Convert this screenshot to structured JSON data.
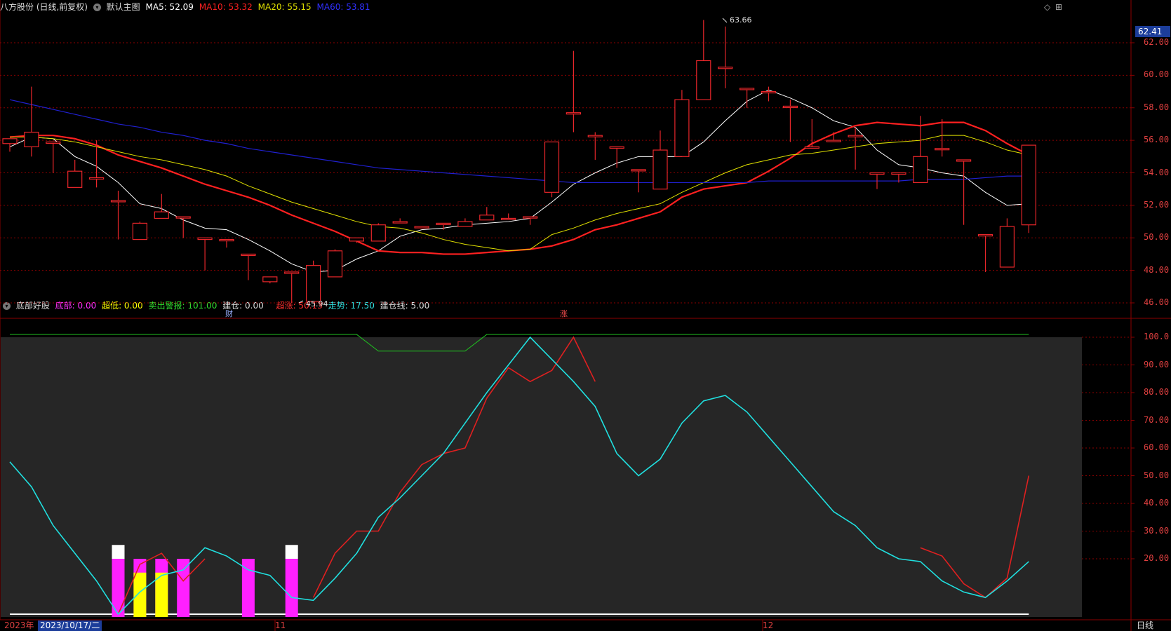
{
  "header_top": {
    "stock_label": "八方股份 (日线,前复权)",
    "main_chart_label": "默认主图",
    "ma5": "MA5: 52.09",
    "ma10": "MA10: 53.32",
    "ma20": "MA20: 55.15",
    "ma60": "MA60: 53.81"
  },
  "header_bottom": {
    "indicator_name": "底部好股",
    "dibu": "底部: 0.00",
    "chaodi": "超低: 0.00",
    "maichu": "卖出警报: 101.00",
    "jiancang": "建仓: 0.00",
    "chaozhang": "超涨: 50.13",
    "zoushi": "走势: 17.50",
    "jiancangxian": "建仓线: 5.00"
  },
  "price_axis_labels": [
    "62.00",
    "60.00",
    "58.00",
    "56.00",
    "54.00",
    "52.00",
    "50.00",
    "48.00",
    "46.00"
  ],
  "current_price_tag": "62.41",
  "indicator_axis_labels": [
    "100.0",
    "90.00",
    "80.00",
    "70.00",
    "60.00",
    "50.00",
    "40.00",
    "30.00",
    "20.00"
  ],
  "annotations": {
    "high": "63.66",
    "low": "45.94",
    "cai": "财",
    "zhang": "涨"
  },
  "date_axis": {
    "year": "2023年",
    "selected_date": "2023/10/17/二",
    "month_11": "11",
    "month_12": "12",
    "period": "日线"
  },
  "icons": {
    "collapse": "chevron-down-icon",
    "diamond": "diamond-icon",
    "settings": "settings-icon"
  },
  "colors": {
    "up": "#e8262a",
    "down": "#00f0f0",
    "ma5": "#ffffff",
    "ma10": "#ff2020",
    "ma20": "#e0e000",
    "ma60": "#2020d0",
    "grid": "#8b0000"
  },
  "chart_data": [
    {
      "type": "candlestick",
      "title": "八方股份 (日线,前复权)",
      "ylim": [
        45,
        63.5
      ],
      "series": [
        {
          "name": "K线",
          "ohlc": [
            [
              55.8,
              56.1,
              55.6,
              55.3
            ],
            [
              55.6,
              56.5,
              55.0,
              59.3
            ],
            [
              55.9,
              55.9,
              54.1,
              54.0
            ],
            [
              53.1,
              54.1,
              53.1,
              54.8
            ],
            [
              53.7,
              53.7,
              53.1,
              56.0
            ],
            [
              52.3,
              52.3,
              49.9,
              52.9
            ],
            [
              49.9,
              50.9,
              49.9,
              51.0
            ],
            [
              51.2,
              51.6,
              51.2,
              52.7
            ],
            [
              51.3,
              51.3,
              50.0,
              50.0
            ],
            [
              49.9,
              50.0,
              49.9,
              48.0
            ],
            [
              49.9,
              49.9,
              49.4,
              49.4
            ],
            [
              49.0,
              49.0,
              47.9,
              47.4
            ],
            [
              47.3,
              47.6,
              47.3,
              47.2
            ],
            [
              47.9,
              47.9,
              46.1,
              46.0
            ],
            [
              46.1,
              48.3,
              46.1,
              48.6
            ],
            [
              47.6,
              49.2,
              47.6,
              49.3
            ],
            [
              49.8,
              50.0,
              49.8,
              49.7
            ],
            [
              49.8,
              50.8,
              49.8,
              50.9
            ],
            [
              51.0,
              51.0,
              50.9,
              51.2
            ],
            [
              50.7,
              50.7,
              50.6,
              50.6
            ],
            [
              50.9,
              50.9,
              50.8,
              50.5
            ],
            [
              50.7,
              51.0,
              50.7,
              51.2
            ],
            [
              51.1,
              51.4,
              51.1,
              51.9
            ],
            [
              51.2,
              51.2,
              51.1,
              51.5
            ],
            [
              51.3,
              51.3,
              50.8,
              50.8
            ],
            [
              52.8,
              55.9,
              52.8,
              52.5
            ],
            [
              57.7,
              57.7,
              56.5,
              61.5
            ],
            [
              56.3,
              56.3,
              54.8,
              56.5
            ],
            [
              55.6,
              55.6,
              54.9,
              54.3
            ],
            [
              54.2,
              54.2,
              52.8,
              52.8
            ],
            [
              53.0,
              55.4,
              53.0,
              56.6
            ],
            [
              55.0,
              58.5,
              55.0,
              59.1
            ],
            [
              58.5,
              60.9,
              58.5,
              63.4
            ],
            [
              60.5,
              60.5,
              59.2,
              63.0
            ],
            [
              59.2,
              59.2,
              59.0,
              58.0
            ],
            [
              59.0,
              59.0,
              58.4,
              59.3
            ],
            [
              58.1,
              58.1,
              55.9,
              58.5
            ],
            [
              55.6,
              55.6,
              55.6,
              57.3
            ],
            [
              56.0,
              56.0,
              56.1,
              56.5
            ],
            [
              56.3,
              56.3,
              54.2,
              56.8
            ],
            [
              54.0,
              54.0,
              54.0,
              53.0
            ],
            [
              54.0,
              54.0,
              53.4,
              53.6
            ],
            [
              53.4,
              55.0,
              53.4,
              57.5
            ],
            [
              55.5,
              55.5,
              55.0,
              57.3
            ],
            [
              54.8,
              54.8,
              50.9,
              50.8
            ],
            [
              50.2,
              50.2,
              48.0,
              47.9
            ],
            [
              48.2,
              50.7,
              48.2,
              51.2
            ],
            [
              50.8,
              55.7,
              50.8,
              50.3
            ]
          ]
        },
        {
          "name": "MA5",
          "values": [
            55.6,
            56.2,
            56.1,
            55.0,
            54.4,
            53.4,
            52.1,
            51.8,
            51.1,
            50.6,
            50.5,
            49.9,
            49.2,
            48.4,
            47.9,
            48.0,
            48.7,
            49.2,
            50.1,
            50.5,
            50.6,
            50.8,
            50.9,
            51.0,
            51.2,
            52.2,
            53.3,
            54.0,
            54.6,
            55.0,
            55.0,
            55.0,
            55.9,
            57.2,
            58.4,
            59.1,
            58.6,
            58.0,
            57.2,
            56.8,
            55.4,
            54.5,
            54.3,
            54.0,
            53.8,
            52.8,
            52.0,
            52.1
          ]
        },
        {
          "name": "MA10",
          "values": [
            56.2,
            56.3,
            56.3,
            56.1,
            55.7,
            55.1,
            54.7,
            54.3,
            53.8,
            53.3,
            52.9,
            52.5,
            52.0,
            51.4,
            50.9,
            50.4,
            49.8,
            49.2,
            49.1,
            49.1,
            49.0,
            49.0,
            49.1,
            49.2,
            49.3,
            49.5,
            49.9,
            50.5,
            50.8,
            51.2,
            51.6,
            52.5,
            53.0,
            53.2,
            53.4,
            54.1,
            54.9,
            55.8,
            56.4,
            56.9,
            57.1,
            57.0,
            56.9,
            57.1,
            57.1,
            56.6,
            55.8,
            55.1
          ]
        },
        {
          "name": "MA20",
          "values": [
            56.2,
            56.2,
            56.1,
            55.9,
            55.6,
            55.3,
            55.0,
            54.8,
            54.5,
            54.2,
            53.8,
            53.2,
            52.7,
            52.2,
            51.8,
            51.4,
            51.0,
            50.7,
            50.6,
            50.3,
            49.9,
            49.6,
            49.4,
            49.2,
            49.3,
            50.2,
            50.6,
            51.1,
            51.5,
            51.8,
            52.1,
            52.8,
            53.4,
            54.0,
            54.5,
            54.8,
            55.1,
            55.2,
            55.4,
            55.6,
            55.8,
            55.9,
            56.0,
            56.3,
            56.3,
            55.9,
            55.4,
            55.1
          ]
        },
        {
          "name": "MA60",
          "values": [
            58.5,
            58.2,
            57.9,
            57.6,
            57.3,
            57.0,
            56.8,
            56.5,
            56.3,
            56.0,
            55.8,
            55.5,
            55.3,
            55.1,
            54.9,
            54.7,
            54.5,
            54.3,
            54.2,
            54.1,
            54.0,
            53.9,
            53.8,
            53.7,
            53.6,
            53.5,
            53.4,
            53.4,
            53.4,
            53.4,
            53.4,
            53.4,
            53.4,
            53.4,
            53.4,
            53.5,
            53.5,
            53.5,
            53.5,
            53.5,
            53.5,
            53.5,
            53.6,
            53.6,
            53.6,
            53.7,
            53.8,
            53.8
          ]
        }
      ]
    },
    {
      "type": "line",
      "title": "底部好股",
      "ylim": [
        -5,
        105
      ],
      "series": [
        {
          "name": "走势",
          "values": [
            55,
            46,
            32,
            22,
            12,
            0,
            8,
            14,
            16,
            24,
            21,
            16,
            14,
            6,
            5,
            13,
            22,
            35,
            42,
            50,
            58,
            69,
            80,
            90,
            100,
            92,
            84,
            75,
            58,
            50,
            56,
            69,
            77,
            79,
            73,
            64,
            55,
            46,
            37,
            32,
            24,
            20,
            19,
            12,
            8,
            6,
            12,
            19
          ]
        },
        {
          "name": "超涨",
          "values": [
            null,
            null,
            null,
            null,
            null,
            0,
            18,
            22,
            12,
            20,
            null,
            null,
            null,
            null,
            6,
            22,
            30,
            30,
            44,
            54,
            58,
            60,
            78,
            89,
            84,
            88,
            100,
            84,
            null,
            null,
            null,
            null,
            null,
            null,
            null,
            null,
            null,
            null,
            null,
            null,
            null,
            null,
            24,
            21,
            11,
            6,
            13,
            50
          ]
        },
        {
          "name": "卖出警报",
          "values": [
            101,
            101,
            101,
            101,
            101,
            101,
            101,
            101,
            101,
            101,
            101,
            101,
            101,
            101,
            101,
            101,
            101,
            95,
            95,
            95,
            95,
            95,
            101,
            101,
            101,
            101,
            101,
            101,
            101,
            101,
            101,
            101,
            101,
            101,
            101,
            101,
            101,
            101,
            101,
            101,
            101,
            101,
            101,
            101,
            101,
            101,
            101,
            101
          ]
        },
        {
          "name": "建仓线",
          "values": [
            0,
            0,
            0,
            0,
            0,
            0,
            0,
            0,
            0,
            0,
            0,
            0,
            0,
            0,
            0,
            0,
            0,
            0,
            0,
            0,
            0,
            0,
            0,
            0,
            0,
            0,
            0,
            0,
            0,
            0,
            0,
            0,
            0,
            0,
            0,
            0,
            0,
            0,
            0,
            0,
            0,
            0,
            0,
            0,
            0,
            0,
            0,
            0
          ]
        }
      ],
      "bars": [
        {
          "x": 5,
          "magenta": 20,
          "white": 25
        },
        {
          "x": 6,
          "magenta": 20,
          "yellow": 15
        },
        {
          "x": 7,
          "magenta": 20,
          "yellow": 15
        },
        {
          "x": 8,
          "magenta": 20
        },
        {
          "x": 11,
          "magenta": 20
        },
        {
          "x": 13,
          "magenta": 20,
          "white": 25
        }
      ]
    }
  ]
}
